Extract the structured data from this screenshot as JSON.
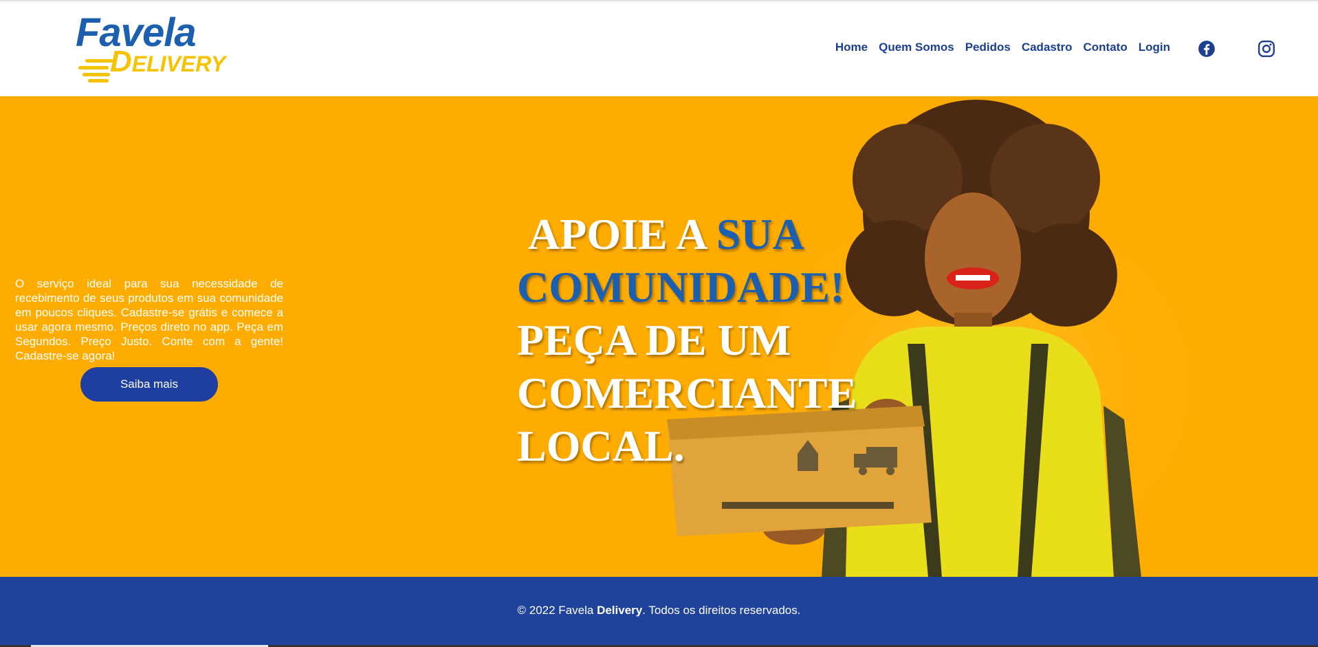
{
  "brand": {
    "logo_main": "Favela",
    "logo_sub_initial": "D",
    "logo_sub_rest": "ELIVERY",
    "primary_color": "#1b5fae",
    "accent_color": "#f5c300"
  },
  "nav": {
    "items": [
      {
        "label": "Home"
      },
      {
        "label": "Quem Somos"
      },
      {
        "label": "Pedidos"
      },
      {
        "label": "Cadastro"
      },
      {
        "label": "Contato"
      },
      {
        "label": "Login"
      }
    ],
    "social": [
      "facebook-icon",
      "instagram-icon"
    ]
  },
  "hero": {
    "background_color": "#ffac00",
    "description": "O serviço ideal para sua necessidade de recebimento de seus produtos em sua comunidade em poucos cliques. Cadastre-se grátis e comece a usar agora mesmo. Preços direto no app. Peça em Segundos. Preço Justo. Conte com a gente! Cadastre-se agora!",
    "cta_label": "Saiba mais",
    "headline": {
      "part1": "APOIE A ",
      "part2": "SUA",
      "line2": "COMUNIDADE!",
      "line3": "PEÇA DE UM",
      "line4": "COMERCIANTE",
      "line5": "LOCAL."
    }
  },
  "footer": {
    "copyright_prefix": "© 2022 Favela ",
    "copyright_bold": "Delivery",
    "copyright_suffix": ". Todos os direitos reservados.",
    "background_color": "#1f429b"
  }
}
